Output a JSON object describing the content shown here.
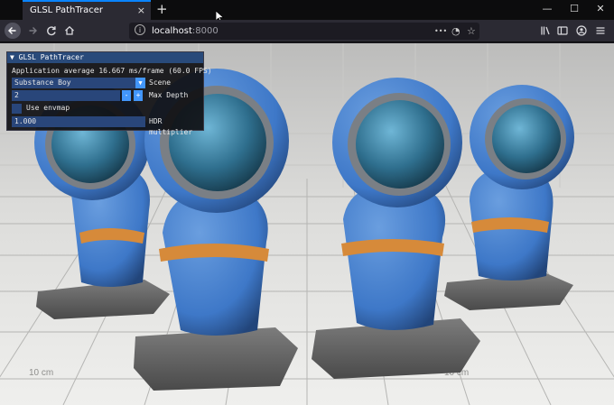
{
  "browser": {
    "tab_title": "GLSL PathTracer",
    "tab_close": "×",
    "new_tab": "+",
    "window_controls": {
      "minimize": "—",
      "maximize": "☐",
      "close": "✕"
    },
    "url_host": "localhost",
    "url_port": ":8000",
    "url_actions": {
      "more": "•••",
      "pocket": "◔",
      "star": "☆"
    },
    "toolbar_icons": [
      "library-icon",
      "sidebar-icon",
      "account-icon",
      "menu-icon"
    ]
  },
  "scene": {
    "floor_label": "10 cm",
    "figure_body_color": "#3e78c8",
    "figure_stripe_color": "#d68a3a",
    "visor_color": "#2f6f8e"
  },
  "panel": {
    "title": "GLSL PathTracer",
    "perf_text": "Application average 16.667 ms/frame (60.0 FPS)",
    "scene_value": "Substance Boy",
    "scene_label": "Scene",
    "max_depth_value": "2",
    "minus": "-",
    "plus": "+",
    "max_depth_label": "Max Depth",
    "envmap_label": "Use envmap",
    "envmap_checked": false,
    "hdr_value": "1.000",
    "hdr_label": "HDR multiplier"
  }
}
